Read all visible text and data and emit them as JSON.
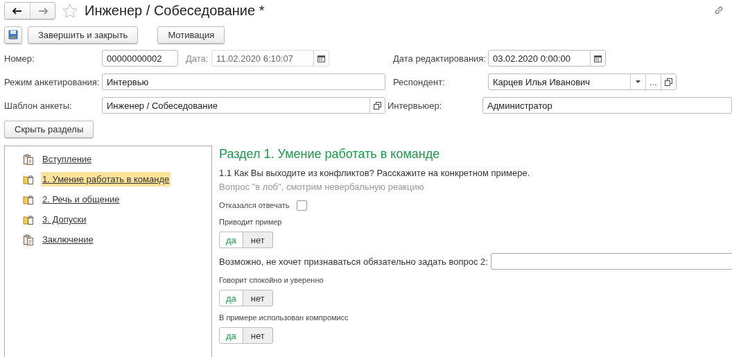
{
  "window": {
    "title": "Инженер / Собеседование *",
    "favorite": false
  },
  "toolbar": {
    "buttons": [
      "Завершить и закрыть",
      "Мотивация"
    ]
  },
  "fields": {
    "number": {
      "label": "Номер:",
      "value": "00000000002"
    },
    "date": {
      "label": "Дата:",
      "value": "11.02.2020  6:10:07",
      "disabled": true
    },
    "edit_date": {
      "label": "Дата редактирования:",
      "value": "03.02.2020  0:00:00"
    },
    "mode": {
      "label": "Режим анкетирования:",
      "value": "Интервью"
    },
    "respondent": {
      "label": "Респондент:",
      "value": "Карцев Илья Иванович",
      "more": "..."
    },
    "template": {
      "label": "Шаблон анкеты:",
      "value": "Инженер / Собеседование"
    },
    "interviewer": {
      "label": "Интервьюер:",
      "value": "Администратор"
    }
  },
  "hide_sections_button": "Скрыть разделы",
  "sections": [
    {
      "label": "Вступление",
      "kind": "page",
      "selected": false
    },
    {
      "label": "1. Умение работать в команде",
      "kind": "section",
      "selected": true
    },
    {
      "label": "2. Речь и общение",
      "kind": "section",
      "selected": false
    },
    {
      "label": "3. Допуски",
      "kind": "section",
      "selected": false
    },
    {
      "label": "Заключение",
      "kind": "page",
      "selected": false
    }
  ],
  "content": [
    {
      "kind": "heading",
      "text": "Раздел 1. Умение работать в команде"
    },
    {
      "kind": "question",
      "text": "1.1 Как Вы выходите из конфликтов? Расскажите на конкретном примере."
    },
    {
      "kind": "hint",
      "text": "Вопрос \"в лоб\", смотрим невербальную реакцию"
    },
    {
      "kind": "checkbox",
      "text": "Отказался отвечать",
      "checked": false
    },
    {
      "kind": "label",
      "text": "Приводит пример"
    },
    {
      "kind": "toggle",
      "options": [
        {
          "text": "да",
          "color": "#1a9a4a"
        },
        {
          "text": "нет",
          "color": "#333333"
        }
      ]
    },
    {
      "kind": "input",
      "text": "Возможно, не хочет признаваться обязательно задать вопрос 2:"
    },
    {
      "kind": "label",
      "text": "Говорит спокойно и уверенно"
    },
    {
      "kind": "toggle",
      "options": [
        {
          "text": "да",
          "color": "#1a9a4a"
        },
        {
          "text": "нет",
          "color": "#333333"
        }
      ]
    },
    {
      "kind": "label",
      "text": "В примере использован компромисс"
    },
    {
      "kind": "toggle",
      "options": [
        {
          "text": "да",
          "color": "#1a9a4a"
        },
        {
          "text": "нет",
          "color": "#333333"
        }
      ]
    }
  ]
}
